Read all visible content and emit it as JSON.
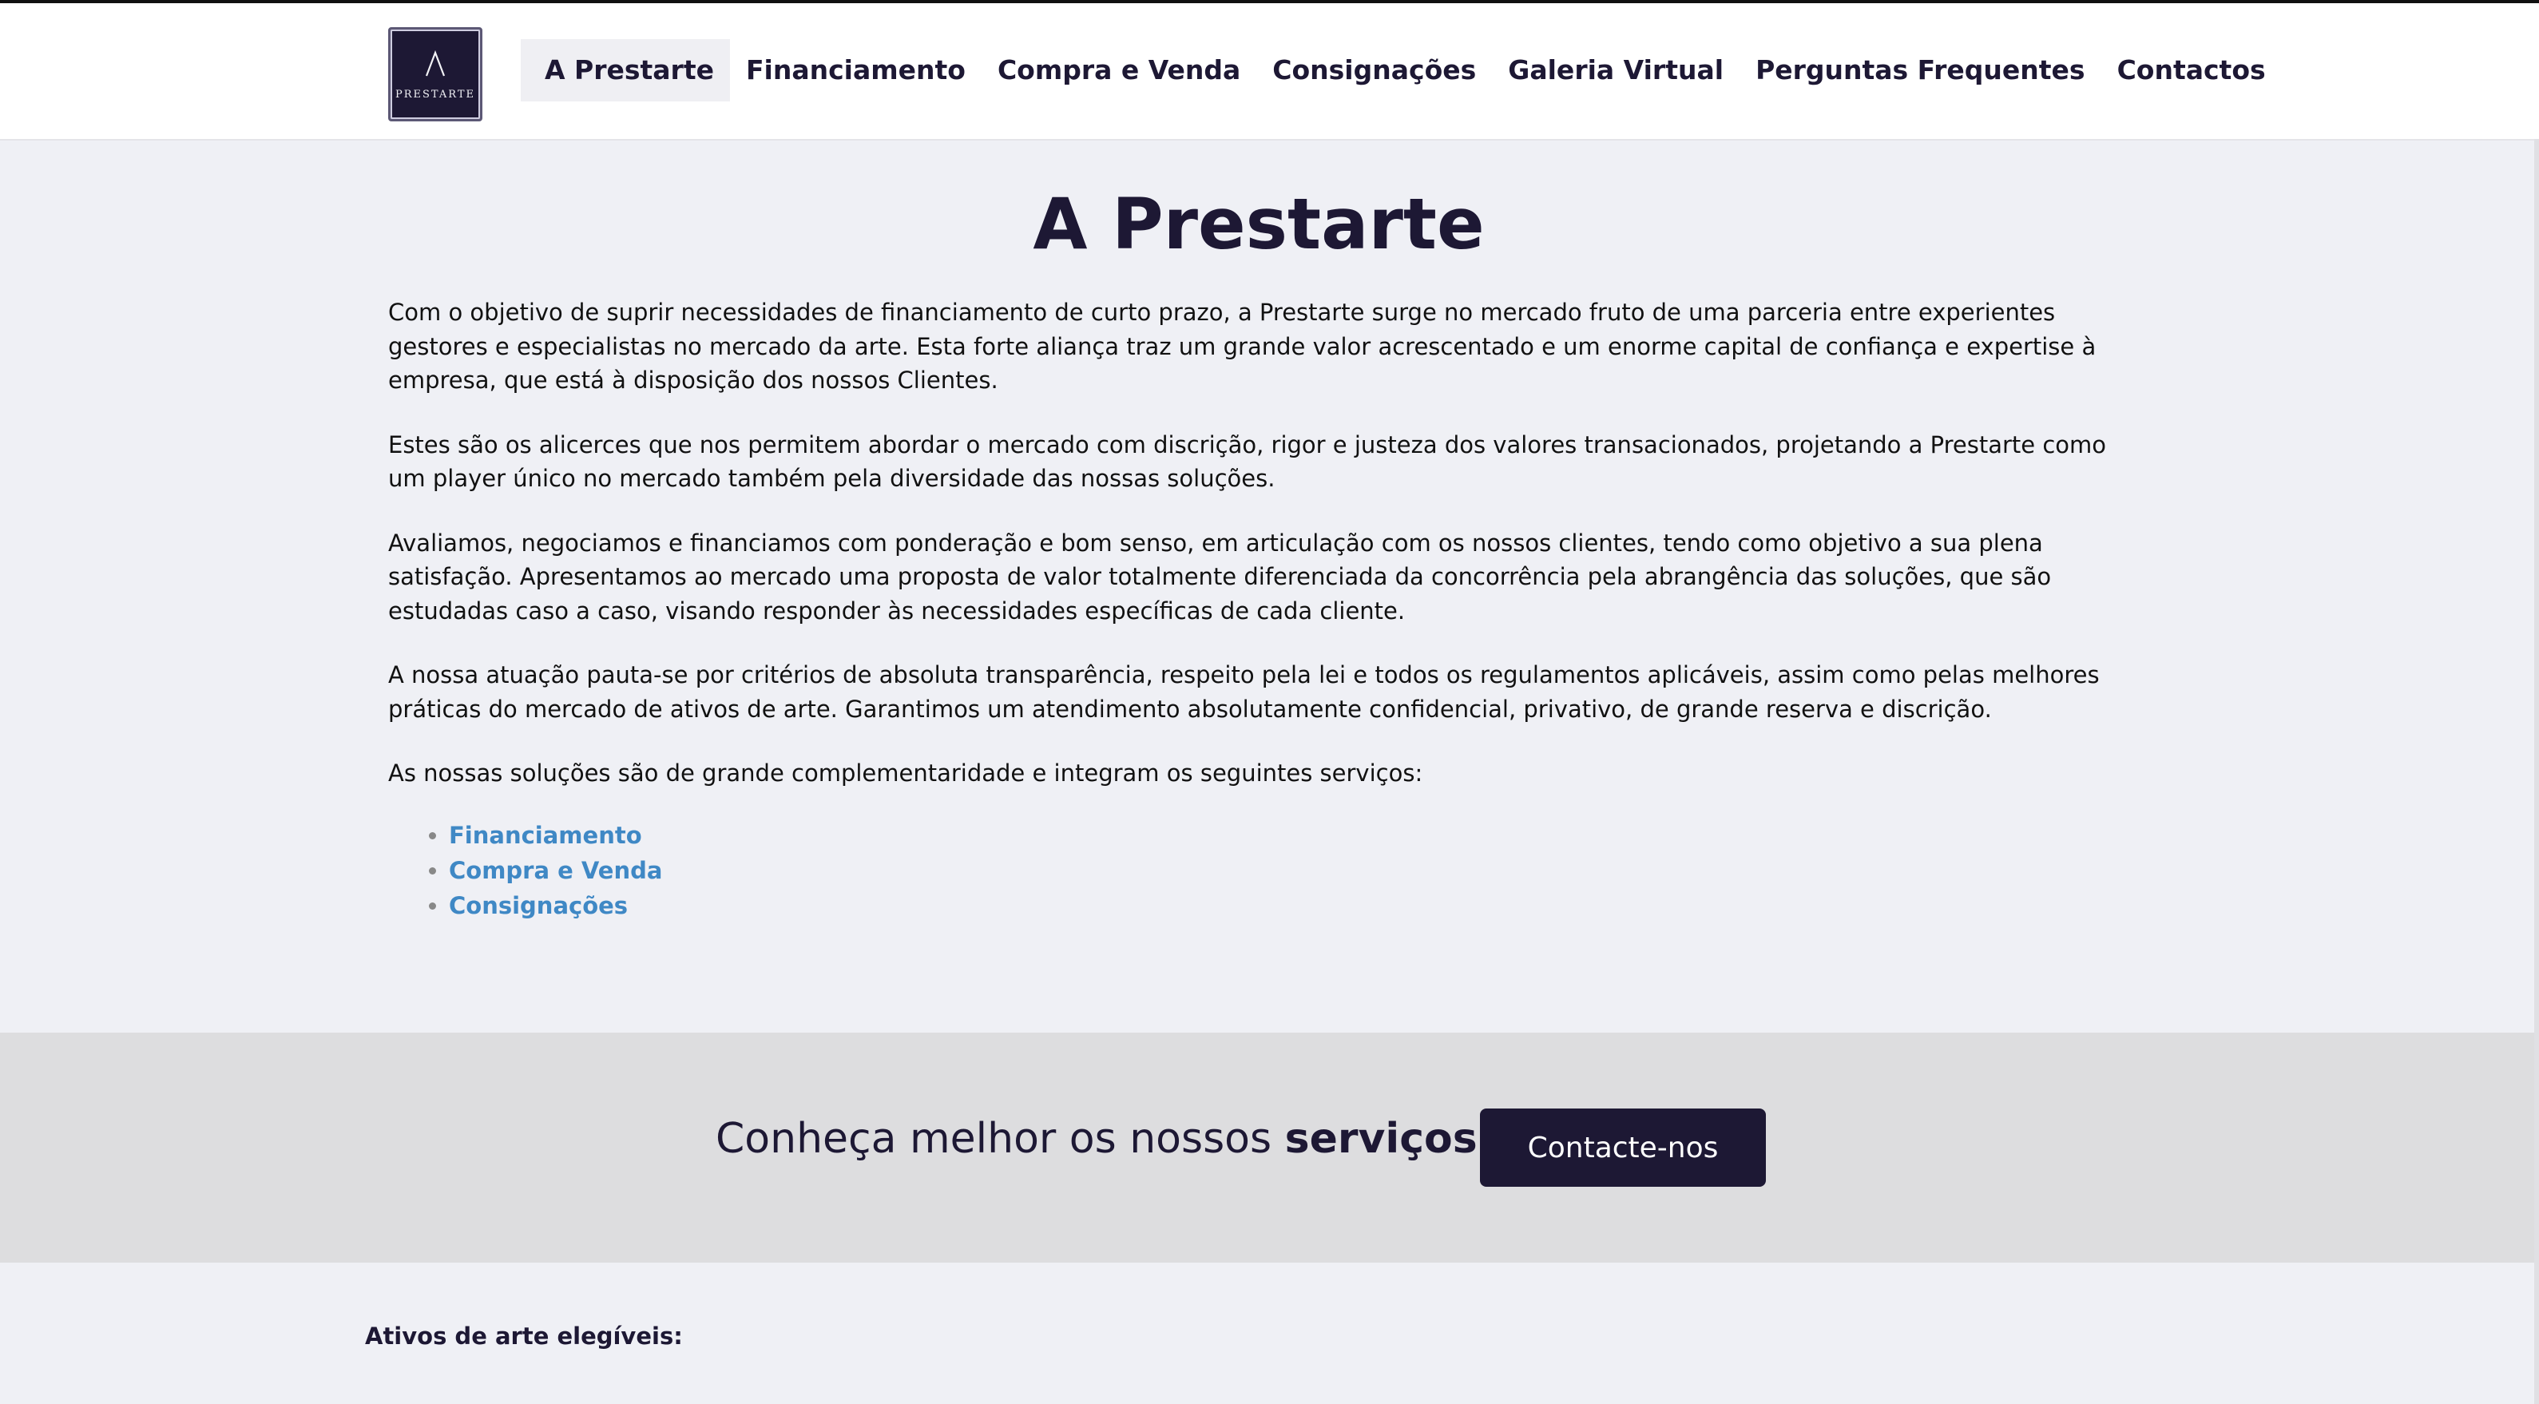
{
  "brand": {
    "logo_text": "PRESTARTE",
    "color": "#1d1834"
  },
  "nav": {
    "items": [
      {
        "label": "A Prestarte",
        "active": true
      },
      {
        "label": "Financiamento"
      },
      {
        "label": "Compra e Venda"
      },
      {
        "label": "Consignações"
      },
      {
        "label": "Galeria Virtual"
      },
      {
        "label": "Perguntas Frequentes"
      },
      {
        "label": "Contactos"
      }
    ]
  },
  "main": {
    "title": "A Prestarte",
    "paragraphs": [
      "Com o objetivo de suprir necessidades de financiamento de curto prazo, a Prestarte surge no mercado fruto de uma parceria entre experientes gestores e especialistas no mercado da arte. Esta forte aliança traz um grande valor acrescentado e um enorme capital de confiança e expertise à empresa, que está à disposição dos nossos Clientes.",
      "Estes são os alicerces que nos permitem abordar o mercado com discrição, rigor e justeza dos valores transacionados, projetando a Prestarte como um player único no mercado também pela diversidade das nossas soluções.",
      "Avaliamos, negociamos e financiamos com ponderação e bom senso, em articulação com os nossos clientes, tendo como objetivo a sua plena satisfação. Apresentamos ao mercado uma proposta de valor totalmente diferenciada da concorrência pela abrangência das soluções, que são estudadas caso a caso, visando responder às necessidades específicas de cada cliente.",
      "A nossa atuação pauta-se por critérios de absoluta transparência, respeito pela lei e todos os regulamentos aplicáveis, assim como pelas melhores práticas do mercado de ativos de arte. Garantimos um atendimento absolutamente confidencial, privativo, de grande reserva e discrição.",
      "As nossas soluções são de grande complementaridade e integram os seguintes serviços:"
    ],
    "services": [
      "Financiamento",
      "Compra e Venda",
      "Consignações"
    ],
    "link_color": "#3f88c5"
  },
  "cta": {
    "text_prefix": "Conheça melhor os nossos ",
    "text_bold": "serviços",
    "text_suffix": ".",
    "button_label": "Contacte-nos"
  },
  "footer_section": {
    "heading": "Ativos de arte elegíveis:"
  }
}
